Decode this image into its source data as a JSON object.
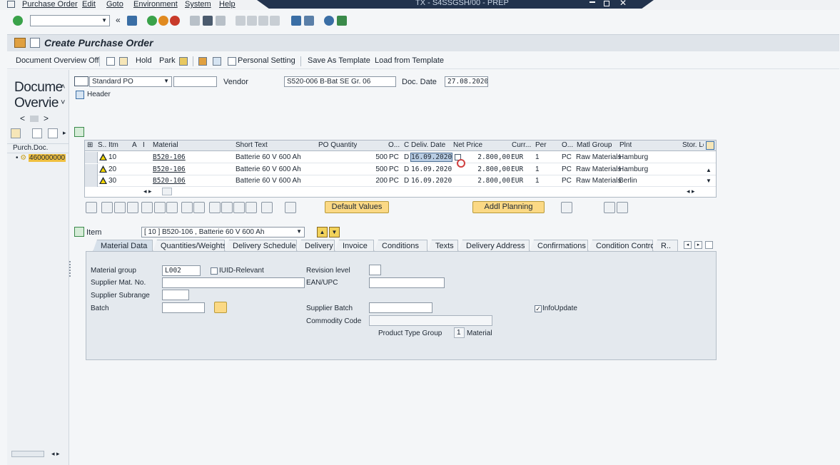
{
  "menu": {
    "items": [
      "Purchase Order",
      "Edit",
      "Goto",
      "Environment",
      "System",
      "Help"
    ],
    "window_title": "TX - S4SSGSH/00 - PREP"
  },
  "page": {
    "title": "Create Purchase Order"
  },
  "app_toolbar": {
    "doc_overview": "Document Overview Off",
    "hold": "Hold",
    "park": "Park",
    "personal_setting": "Personal Setting",
    "save_as_template": "Save As Template",
    "load_from_template": "Load from Template"
  },
  "left_nav": {
    "title_line1": "Docume",
    "title_line2": "Overvie",
    "tree_header": "Purch.Doc.",
    "tree_item": "460000000"
  },
  "header": {
    "order_type": "Standard PO",
    "vendor_label": "Vendor",
    "vendor_value": "S520-006 B-Bat SE Gr. 06",
    "doc_date_label": "Doc. Date",
    "doc_date_value": "27.08.2020",
    "header_label": "Header"
  },
  "grid": {
    "columns": [
      "S..",
      "Itm",
      "A",
      "I",
      "Material",
      "Short Text",
      "PO Quantity",
      "O...",
      "C",
      "Deliv. Date",
      "Net Price",
      "Curr...",
      "Per",
      "O...",
      "Matl Group",
      "Plnt",
      "Stor. Lo"
    ],
    "rows": [
      {
        "item": "10",
        "material": "B520-106",
        "short_text": "Batterie 60 V 600 Ah",
        "qty": "500",
        "uom": "PC",
        "cat": "D",
        "deliv_date": "16.09.2020",
        "net_price": "2.800,00",
        "curr": "EUR",
        "per": "1",
        "oun": "PC",
        "matl_group": "Raw Materials",
        "plant": "Hamburg"
      },
      {
        "item": "20",
        "material": "B520-106",
        "short_text": "Batterie 60 V 600 Ah",
        "qty": "500",
        "uom": "PC",
        "cat": "D",
        "deliv_date": "16.09.2020",
        "net_price": "2.800,00",
        "curr": "EUR",
        "per": "1",
        "oun": "PC",
        "matl_group": "Raw Materials",
        "plant": "Hamburg"
      },
      {
        "item": "30",
        "material": "B520-106",
        "short_text": "Batterie 60 V 600 Ah",
        "qty": "200",
        "uom": "PC",
        "cat": "D",
        "deliv_date": "16.09.2020",
        "net_price": "2.800,00",
        "curr": "EUR",
        "per": "1",
        "oun": "PC",
        "matl_group": "Raw Materials",
        "plant": "Berlin"
      }
    ]
  },
  "grid_toolbar": {
    "default_values": "Default Values",
    "addl_planning": "Addl Planning"
  },
  "item_detail": {
    "item_label": "Item",
    "item_select": "[ 10 ] B520-106 , Batterie 60 V 600 Ah",
    "tabs": [
      "Material Data",
      "Quantities/Weights",
      "Delivery Schedule",
      "Delivery",
      "Invoice",
      "Conditions",
      "Texts",
      "Delivery Address",
      "Confirmations",
      "Condition Control",
      "R.."
    ],
    "fields": {
      "material_group_label": "Material group",
      "material_group_value": "L002",
      "iuid_label": "IUID-Relevant",
      "revision_label": "Revision level",
      "supplier_mat_label": "Supplier Mat. No.",
      "ean_label": "EAN/UPC",
      "supplier_subrange_label": "Supplier Subrange",
      "batch_label": "Batch",
      "supplier_batch_label": "Supplier Batch",
      "info_update_label": "InfoUpdate",
      "commodity_code_label": "Commodity Code",
      "product_type_label": "Product Type Group",
      "product_type_value": "1",
      "product_type_text": "Material"
    }
  }
}
